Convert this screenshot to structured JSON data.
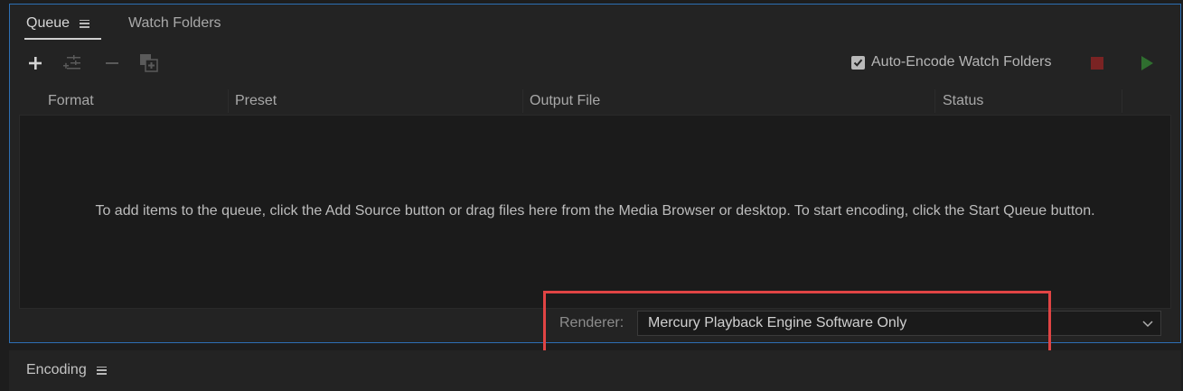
{
  "queue_panel": {
    "tabs": [
      {
        "label": "Queue",
        "active": true
      },
      {
        "label": "Watch Folders",
        "active": false
      }
    ],
    "toolbar": {
      "add_icon": "plus-icon",
      "settings_icon": "sliders-icon",
      "remove_icon": "minus-icon",
      "duplicate_icon": "duplicate-icon",
      "auto_encode_label": "Auto-Encode Watch Folders",
      "auto_encode_checked": true,
      "stop_icon": "stop-icon",
      "start_icon": "play-icon"
    },
    "columns": [
      "Format",
      "Preset",
      "Output File",
      "Status"
    ],
    "empty_message": "To add items to the queue, click the Add Source button or drag files here from the Media Browser or desktop.  To start encoding, click the Start Queue button.",
    "renderer": {
      "label": "Renderer:",
      "value": "Mercury Playback Engine Software Only"
    }
  },
  "encoding_panel": {
    "title": "Encoding"
  },
  "colors": {
    "highlight": "#e04444",
    "panel_border": "#2d6fb4",
    "stop": "#7a2323",
    "start": "#2f6e2f"
  }
}
